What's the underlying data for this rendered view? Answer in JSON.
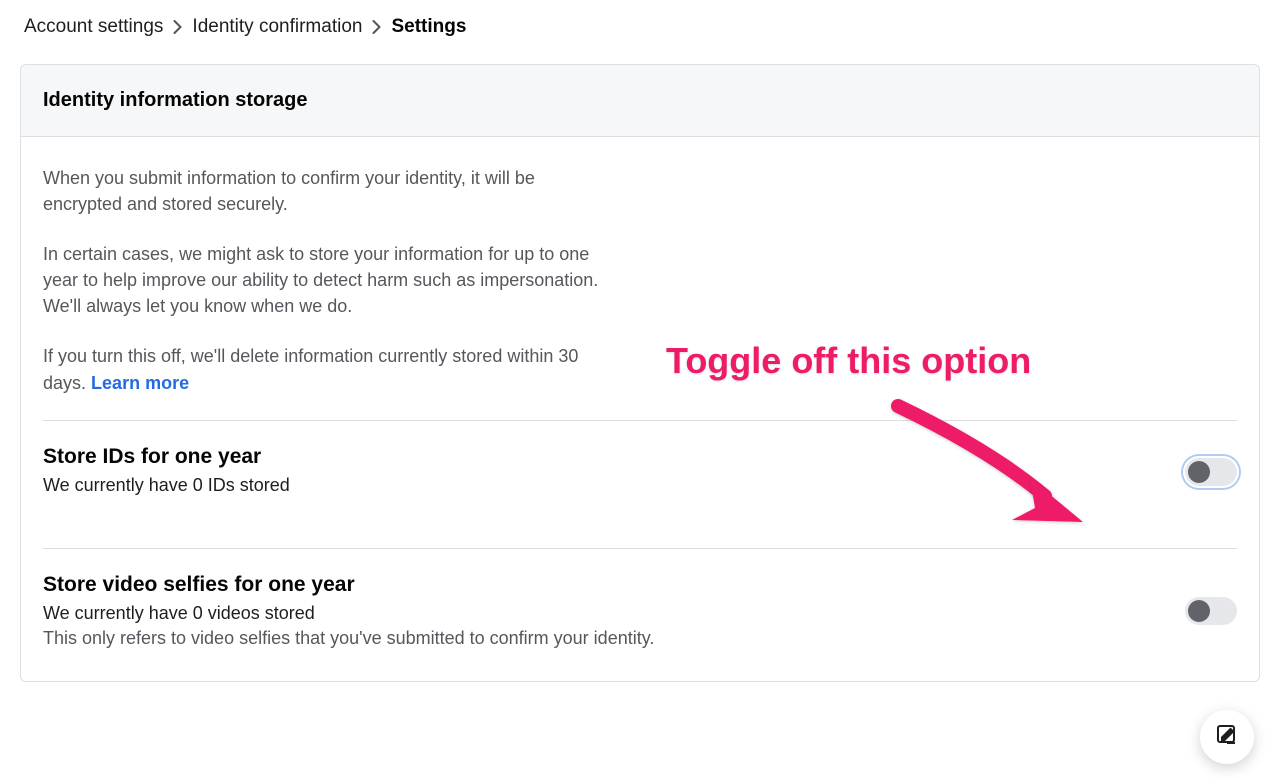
{
  "breadcrumb": [
    {
      "label": "Account settings",
      "current": false
    },
    {
      "label": "Identity confirmation",
      "current": false
    },
    {
      "label": "Settings",
      "current": true
    }
  ],
  "card": {
    "title": "Identity information storage",
    "paragraphs": [
      "When you submit information to confirm your identity, it will be encrypted and stored securely.",
      "In certain cases, we might ask to store your information for up to one year to help improve our ability to detect harm such as impersonation. We'll always let you know when we do.",
      "If you turn this off, we'll delete information currently stored within 30 days."
    ],
    "learn_more": "Learn more"
  },
  "settings": {
    "store_ids": {
      "title": "Store IDs for one year",
      "subtitle": "We currently have 0 IDs stored",
      "note": "",
      "on": false,
      "focused": true
    },
    "store_videos": {
      "title": "Store video selfies for one year",
      "subtitle": "We currently have 0 videos stored",
      "note": "This only refers to video selfies that you've submitted to confirm your identity.",
      "on": false,
      "focused": false
    }
  },
  "annotation": {
    "text": "Toggle off this option"
  }
}
